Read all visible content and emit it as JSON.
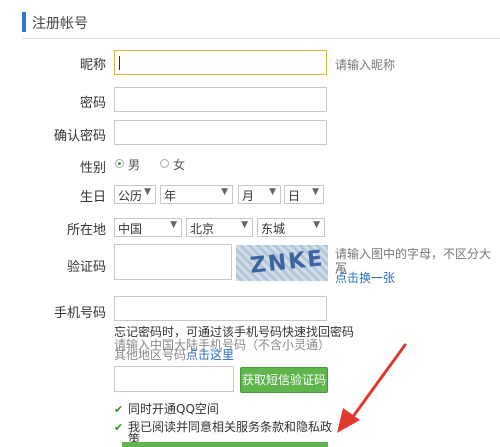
{
  "header": {
    "title": "注册帐号"
  },
  "nickname": {
    "label": "昵称",
    "value": "",
    "hint": "请输入昵称"
  },
  "password": {
    "label": "密码",
    "value": ""
  },
  "confirm_password": {
    "label": "确认密码",
    "value": ""
  },
  "gender": {
    "label": "性别",
    "options": [
      "男",
      "女"
    ],
    "selected": "男"
  },
  "birthday": {
    "label": "生日",
    "calendar": "公历",
    "year": "年",
    "month": "月",
    "day": "日"
  },
  "location": {
    "label": "所在地",
    "country": "中国",
    "province": "北京",
    "city": "东城"
  },
  "captcha": {
    "label": "验证码",
    "value": "",
    "image_text": "ZNKE",
    "hint_line1": "请输入图中的字母，不区分大小",
    "hint_line2": "写",
    "refresh_link": "点击换一张"
  },
  "phone": {
    "label": "手机号码",
    "value": "",
    "note1": "忘记密码时，可通过该手机号码快速找回密码",
    "note2": "请输入中国大陆手机号码（不含小灵通）",
    "note3_prefix": "其他地区号码",
    "note3_link": "点击这里",
    "code_value": "",
    "get_code_button": "获取短信验证码"
  },
  "checkboxes": {
    "qzone": {
      "label": "同时开通QQ空间",
      "checked": true
    },
    "agree_line1": "我已阅读并同意相关服务条款和隐私政",
    "agree_line2": "策",
    "agree_checked": true
  },
  "colors": {
    "accent": "#2a7fd0",
    "button": "#5db54b",
    "arrow": "#e03a2c"
  }
}
